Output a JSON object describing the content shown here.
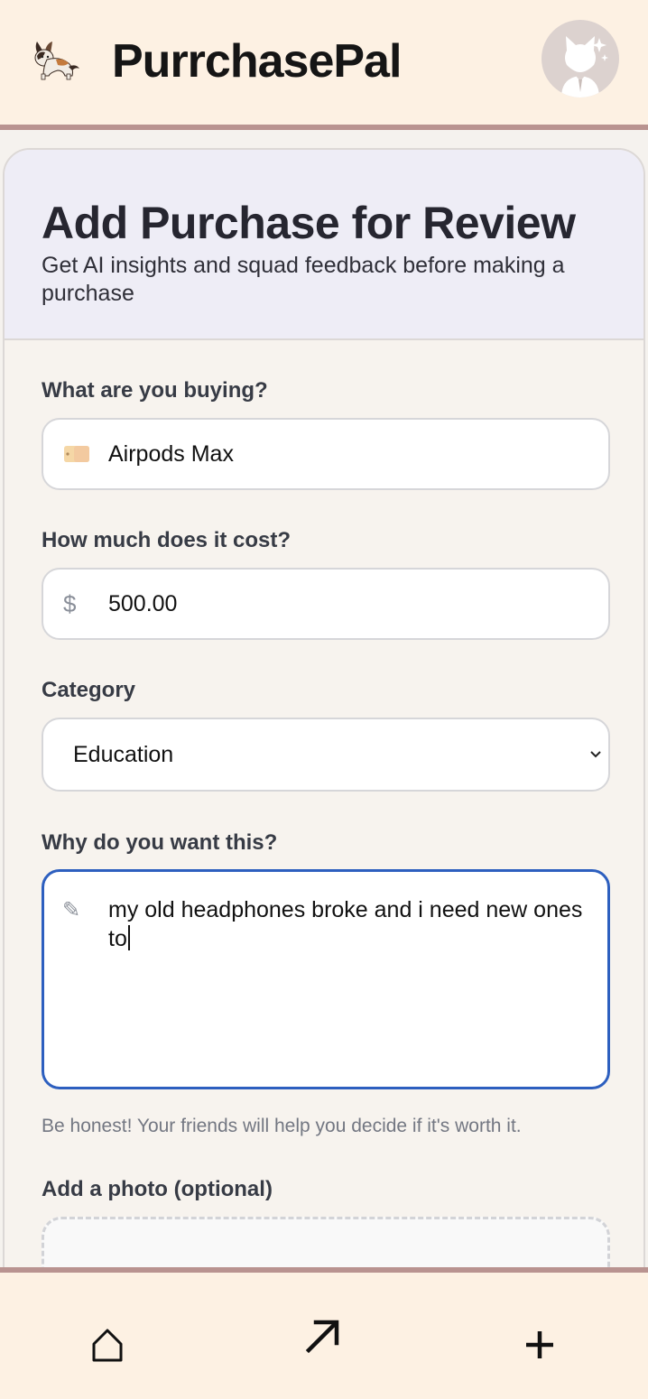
{
  "app": {
    "name": "PurrchasePal",
    "logo_icon": "cat-stretching-icon",
    "avatar_icon": "cat-avatar-icon"
  },
  "form": {
    "title": "Add Purchase for Review",
    "subtitle": "Get AI insights and squad feedback before making a purchase",
    "item": {
      "label": "What are you buying?",
      "icon": "price-tag-icon",
      "value": "Airpods Max"
    },
    "cost": {
      "label": "How much does it cost?",
      "prefix": "$",
      "value": "500.00"
    },
    "category": {
      "label": "Category",
      "selected": "Education"
    },
    "reason": {
      "label": "Why do you want this?",
      "icon": "pencil-icon",
      "value": "my old headphones broke and i need new ones to",
      "hint": "Be honest! Your friends will help you decide if it's worth it."
    },
    "photo": {
      "label": "Add a photo (optional)"
    }
  },
  "bottom_nav": [
    {
      "name": "home",
      "icon": "home-icon"
    },
    {
      "name": "trending",
      "icon": "arrow-up-right-icon"
    },
    {
      "name": "add",
      "icon": "plus-icon"
    }
  ],
  "colors": {
    "header_bg": "#fdf1e3",
    "accent_border": "#b99390",
    "focus_blue": "#2d5fbf",
    "card_head_bg": "#eeedf6"
  }
}
